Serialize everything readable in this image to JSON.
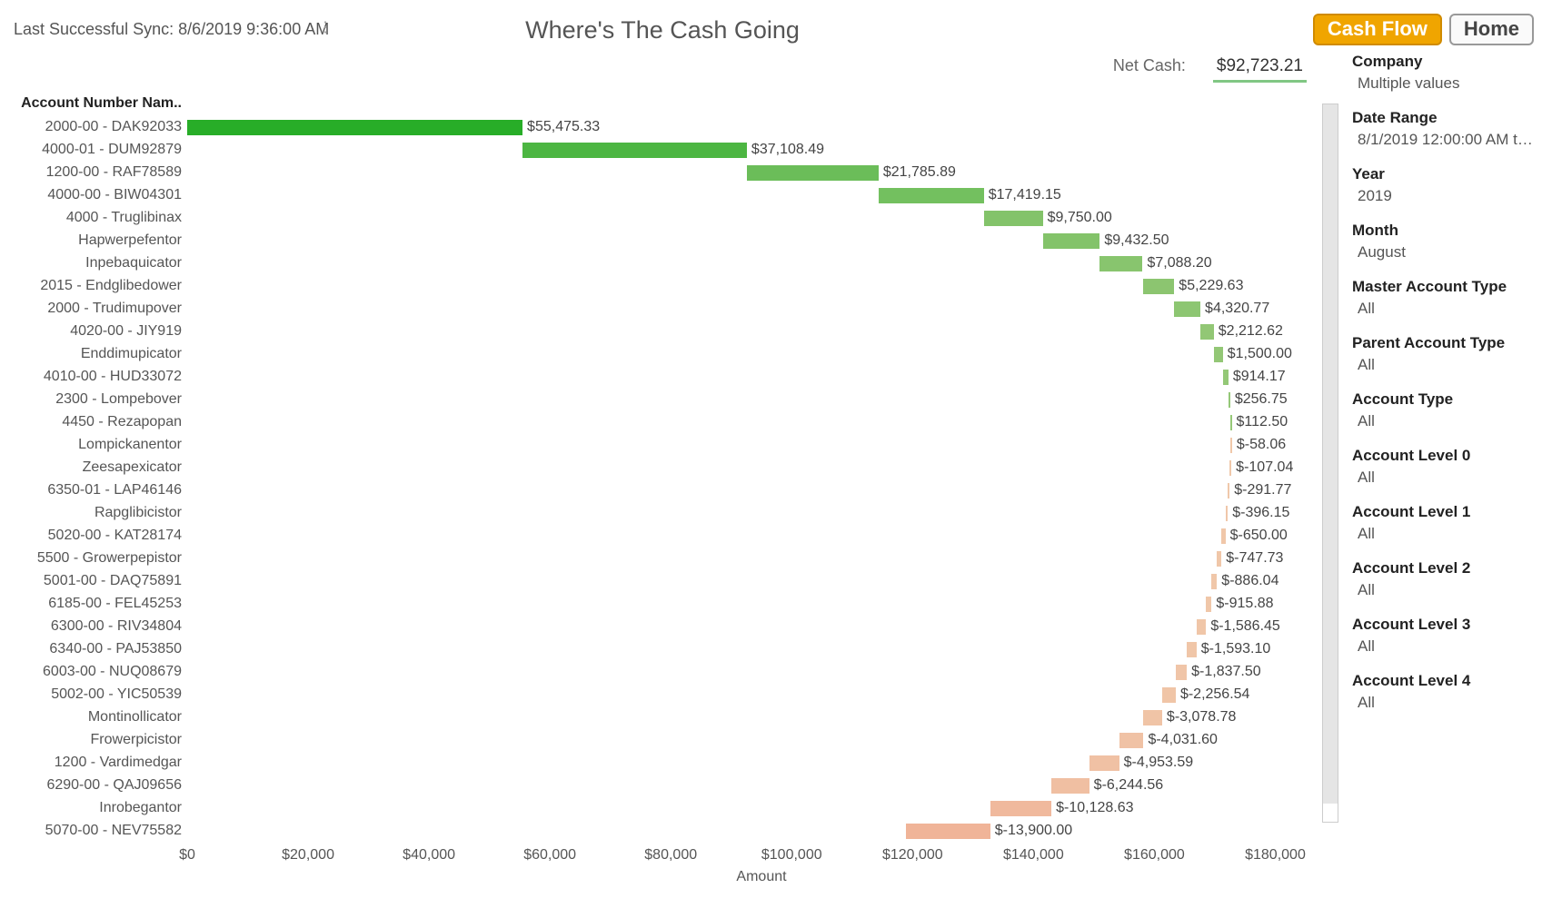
{
  "sync_label": "Last Successful Sync: 8/6/2019 9:36:00 AM",
  "title": "Where's The Cash Going",
  "buttons": {
    "cashflow": "Cash Flow",
    "home": "Home"
  },
  "netcash": {
    "label": "Net Cash:",
    "value": "$92,723.21"
  },
  "filters": [
    {
      "label": "Company",
      "value": "Multiple values"
    },
    {
      "label": "Date Range",
      "value": "8/1/2019 12:00:00 AM to .."
    },
    {
      "label": "Year",
      "value": "2019"
    },
    {
      "label": "Month",
      "value": "August"
    },
    {
      "label": "Master Account Type",
      "value": "All"
    },
    {
      "label": "Parent Account Type",
      "value": "All"
    },
    {
      "label": "Account Type",
      "value": "All"
    },
    {
      "label": "Account Level 0",
      "value": "All"
    },
    {
      "label": "Account Level 1",
      "value": "All"
    },
    {
      "label": "Account Level 2",
      "value": "All"
    },
    {
      "label": "Account Level 3",
      "value": "All"
    },
    {
      "label": "Account Level 4",
      "value": "All"
    }
  ],
  "chart_data": {
    "type": "bar",
    "orientation": "waterfall-horizontal",
    "category_header": "Account Number Nam..",
    "xlabel": "Amount",
    "xlim": [
      0,
      190000
    ],
    "xticks": [
      0,
      20000,
      40000,
      60000,
      80000,
      100000,
      120000,
      140000,
      160000,
      180000
    ],
    "xtick_labels": [
      "$0",
      "$20,000",
      "$40,000",
      "$60,000",
      "$80,000",
      "$100,000",
      "$120,000",
      "$140,000",
      "$160,000",
      "$180,000"
    ],
    "series": [
      {
        "name": "2000-00 - DAK92033",
        "value": 55475.33,
        "label": "$55,475.33"
      },
      {
        "name": "4000-01 - DUM92879",
        "value": 37108.49,
        "label": "$37,108.49"
      },
      {
        "name": "1200-00 - RAF78589",
        "value": 21785.89,
        "label": "$21,785.89"
      },
      {
        "name": "4000-00 - BIW04301",
        "value": 17419.15,
        "label": "$17,419.15"
      },
      {
        "name": "4000 - Truglibinax",
        "value": 9750.0,
        "label": "$9,750.00"
      },
      {
        "name": "Hapwerpefentor",
        "value": 9432.5,
        "label": "$9,432.50"
      },
      {
        "name": "Inpebaquicator",
        "value": 7088.2,
        "label": "$7,088.20"
      },
      {
        "name": "2015 - Endglibedower",
        "value": 5229.63,
        "label": "$5,229.63"
      },
      {
        "name": "2000 - Trudimupover",
        "value": 4320.77,
        "label": "$4,320.77"
      },
      {
        "name": "4020-00 - JIY919",
        "value": 2212.62,
        "label": "$2,212.62"
      },
      {
        "name": "Enddimupicator",
        "value": 1500.0,
        "label": "$1,500.00"
      },
      {
        "name": "4010-00 - HUD33072",
        "value": 914.17,
        "label": "$914.17"
      },
      {
        "name": "2300 - Lompebover",
        "value": 256.75,
        "label": "$256.75"
      },
      {
        "name": "4450 - Rezapopan",
        "value": 112.5,
        "label": "$112.50"
      },
      {
        "name": "Lompickanentor",
        "value": -58.06,
        "label": "$-58.06"
      },
      {
        "name": "Zeesapexicator",
        "value": -107.04,
        "label": "$-107.04"
      },
      {
        "name": "6350-01 - LAP46146",
        "value": -291.77,
        "label": "$-291.77"
      },
      {
        "name": "Rapglibicistor",
        "value": -396.15,
        "label": "$-396.15"
      },
      {
        "name": "5020-00 - KAT28174",
        "value": -650.0,
        "label": "$-650.00"
      },
      {
        "name": "5500 - Growerpepistor",
        "value": -747.73,
        "label": "$-747.73"
      },
      {
        "name": "5001-00 - DAQ75891",
        "value": -886.04,
        "label": "$-886.04"
      },
      {
        "name": "6185-00 - FEL45253",
        "value": -915.88,
        "label": "$-915.88"
      },
      {
        "name": "6300-00 - RIV34804",
        "value": -1586.45,
        "label": "$-1,586.45"
      },
      {
        "name": "6340-00 - PAJ53850",
        "value": -1593.1,
        "label": "$-1,593.10"
      },
      {
        "name": "6003-00 - NUQ08679",
        "value": -1837.5,
        "label": "$-1,837.50"
      },
      {
        "name": "5002-00 - YIC50539",
        "value": -2256.54,
        "label": "$-2,256.54"
      },
      {
        "name": "Montinollicator",
        "value": -3078.78,
        "label": "$-3,078.78"
      },
      {
        "name": "Frowerpicistor",
        "value": -4031.6,
        "label": "$-4,031.60"
      },
      {
        "name": "1200 - Vardimedgar",
        "value": -4953.59,
        "label": "$-4,953.59"
      },
      {
        "name": "6290-00 - QAJ09656",
        "value": -6244.56,
        "label": "$-6,244.56"
      },
      {
        "name": "Inrobegantor",
        "value": -10128.63,
        "label": "$-10,128.63"
      },
      {
        "name": "5070-00 - NEV75582",
        "value": -13900.0,
        "label": "$-13,900.00"
      }
    ]
  }
}
